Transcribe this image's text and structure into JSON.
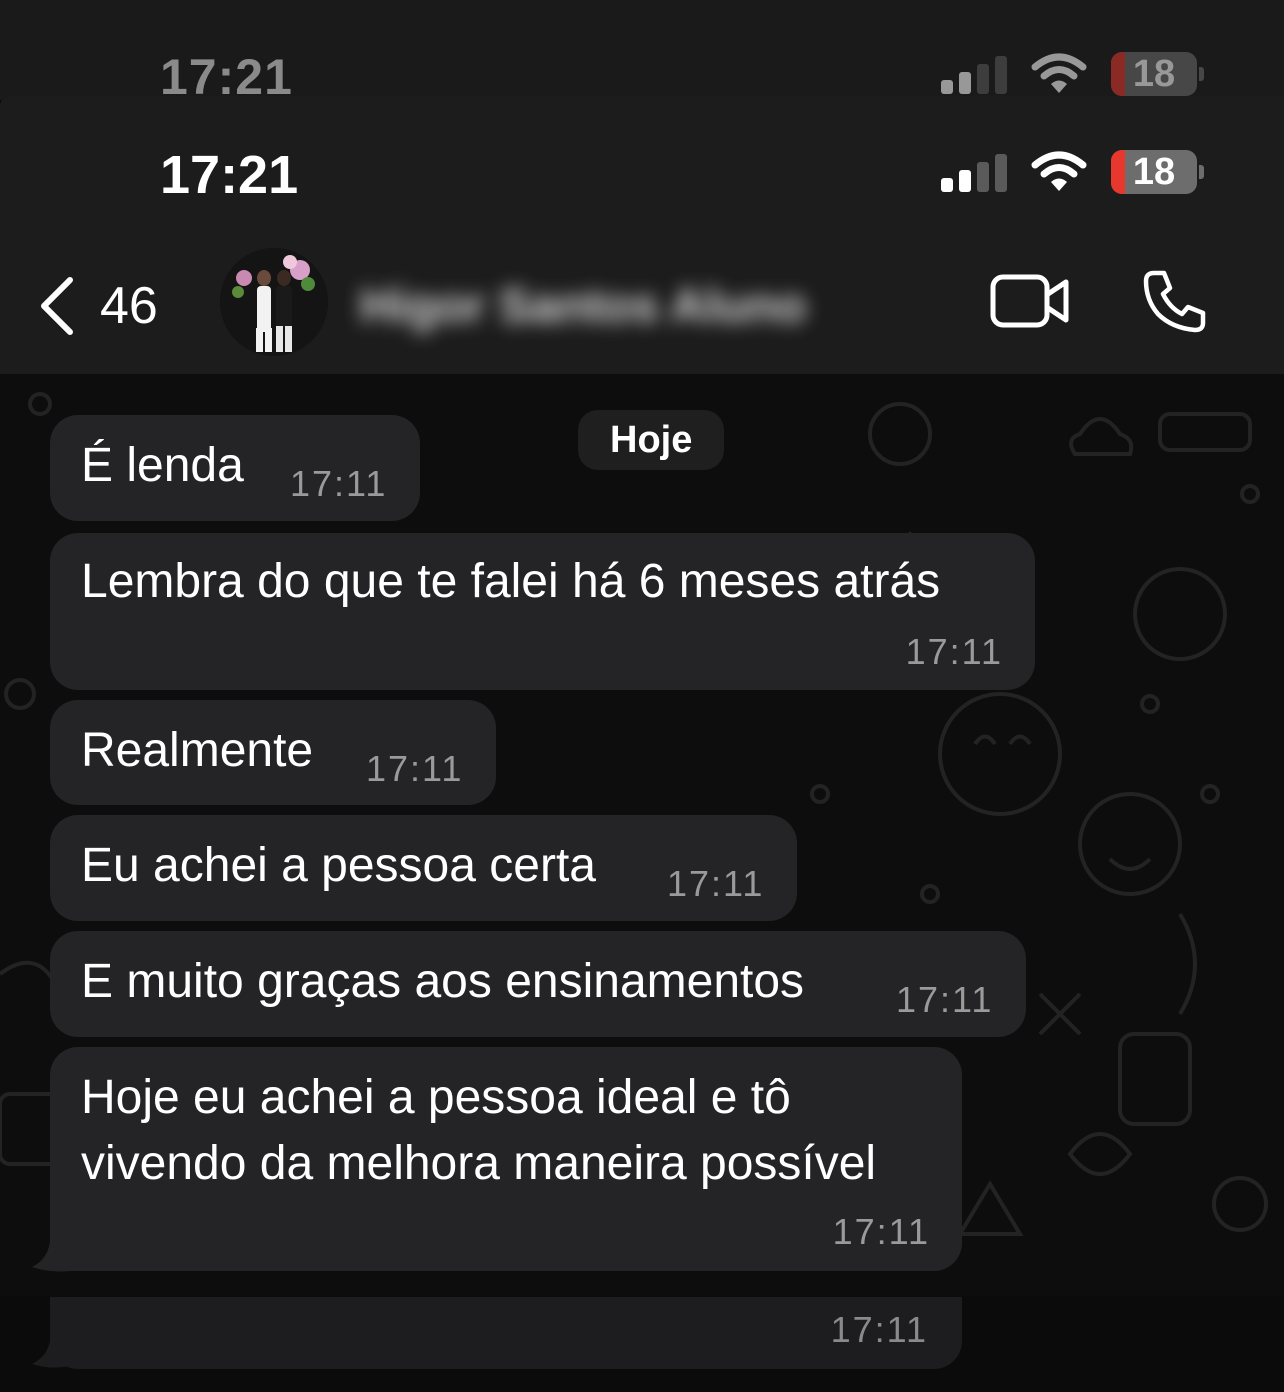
{
  "status_bar": {
    "time": "17:21",
    "battery_level": "18",
    "ghost_time": "17:21",
    "ghost_battery_level": "18"
  },
  "header": {
    "back_count": "46",
    "contact_name": "Higor Santos Aluno",
    "icons": [
      "chevron-left-icon",
      "video-call-icon",
      "phone-icon"
    ]
  },
  "chat": {
    "day_label": "Hoje",
    "messages": [
      {
        "text": "É lenda",
        "time": "17:11"
      },
      {
        "text": "Lembra do que te falei há 6 meses atrás",
        "time": "17:11"
      },
      {
        "text": "Realmente",
        "time": "17:11"
      },
      {
        "text": "Eu achei a pessoa certa",
        "time": "17:11"
      },
      {
        "text": "E muito graças aos ensinamentos",
        "time": "17:11"
      },
      {
        "text_line1": "Hoje eu achei a pessoa ideal e tô",
        "text_line2": "vivendo da melhora maneira possível",
        "time": "17:11"
      }
    ],
    "overlay_time": "17:11"
  },
  "colors": {
    "header_bg": "#1c1c1c",
    "bubble_bg": "#242426",
    "chat_bg": "#0d0d0d",
    "battery_low": "#e8382e"
  }
}
